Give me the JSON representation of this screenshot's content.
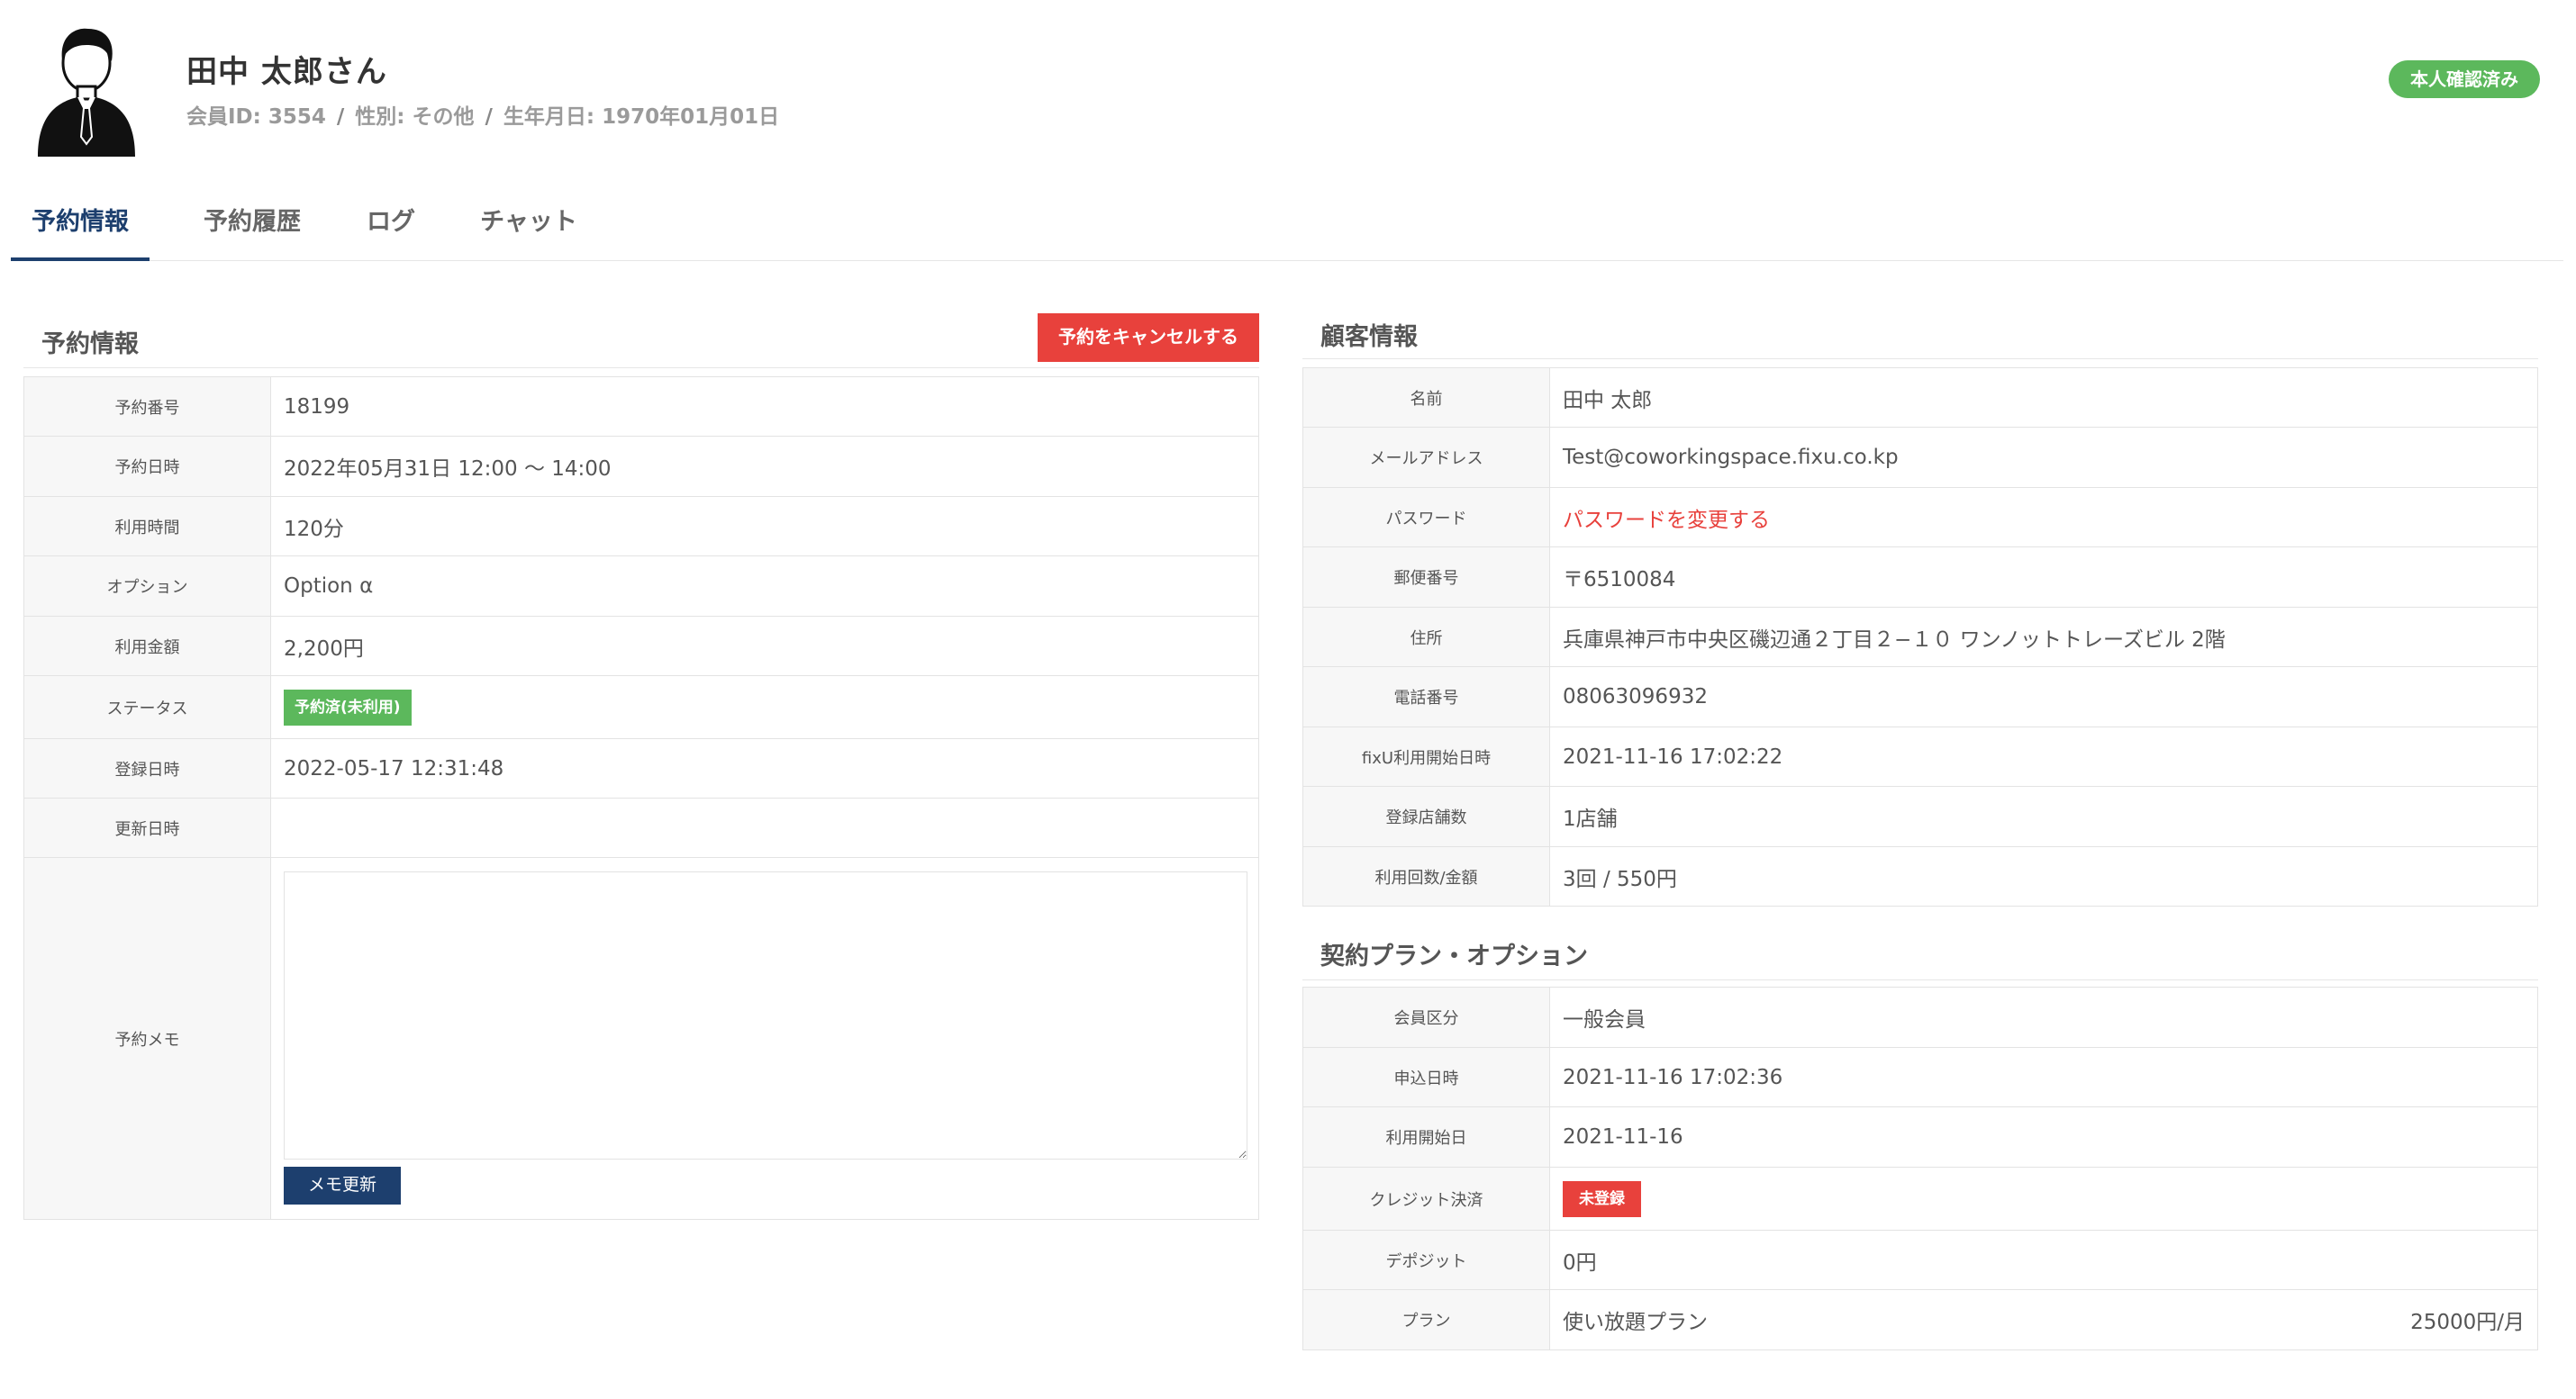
{
  "user": {
    "name": "田中 太郎さん",
    "member_id": "会員ID: 3554",
    "gender": "性別: その他",
    "birthday": "生年月日: 1970年01月01日",
    "verified_badge": "本人確認済み"
  },
  "tabs": [
    {
      "label": "予約情報",
      "active": true
    },
    {
      "label": "予約履歴",
      "active": false
    },
    {
      "label": "ログ",
      "active": false
    },
    {
      "label": "チャット",
      "active": false
    }
  ],
  "reservation": {
    "title": "予約情報",
    "cancel_button": "予約をキャンセルする",
    "rows": [
      {
        "label": "予約番号",
        "value": "18199"
      },
      {
        "label": "予約日時",
        "value": "2022年05月31日 12:00 〜 14:00"
      },
      {
        "label": "利用時間",
        "value": "120分"
      },
      {
        "label": "オプション",
        "value": "Option α"
      },
      {
        "label": "利用金額",
        "value": "2,200円"
      },
      {
        "label": "ステータス",
        "value": "予約済(未利用)"
      },
      {
        "label": "登録日時",
        "value": "2022-05-17 12:31:48"
      },
      {
        "label": "更新日時",
        "value": ""
      }
    ],
    "memo_label": "予約メモ",
    "memo_value": "",
    "memo_button": "メモ更新"
  },
  "customer": {
    "title": "顧客情報",
    "rows": [
      {
        "label": "名前",
        "value": "田中 太郎"
      },
      {
        "label": "メールアドレス",
        "value": "Test@coworkingspace.fixu.co.kp"
      },
      {
        "label": "パスワード",
        "value": "パスワードを変更する"
      },
      {
        "label": "郵便番号",
        "value": "〒6510084"
      },
      {
        "label": "住所",
        "value": "兵庫県神戸市中央区磯辺通２丁目２−１０ ワンノットトレーズビル 2階"
      },
      {
        "label": "電話番号",
        "value": "08063096932"
      },
      {
        "label": "fixU利用開始日時",
        "value": "2021-11-16 17:02:22"
      },
      {
        "label": "登録店舗数",
        "value": "1店舗"
      },
      {
        "label": "利用回数/金額",
        "value": "3回 / 550円"
      }
    ]
  },
  "contract": {
    "title": "契約プラン・オプション",
    "rows": [
      {
        "label": "会員区分",
        "value": "一般会員"
      },
      {
        "label": "申込日時",
        "value": "2021-11-16 17:02:36"
      },
      {
        "label": "利用開始日",
        "value": "2021-11-16"
      },
      {
        "label": "クレジット決済",
        "value": "未登録"
      },
      {
        "label": "デポジット",
        "value": "0円"
      },
      {
        "label": "プラン",
        "value": "使い放題プラン",
        "price": "25000円/月"
      }
    ]
  },
  "colors": {
    "accent": "#1d3f6e",
    "danger": "#e8413c",
    "success": "#5cb85c"
  }
}
